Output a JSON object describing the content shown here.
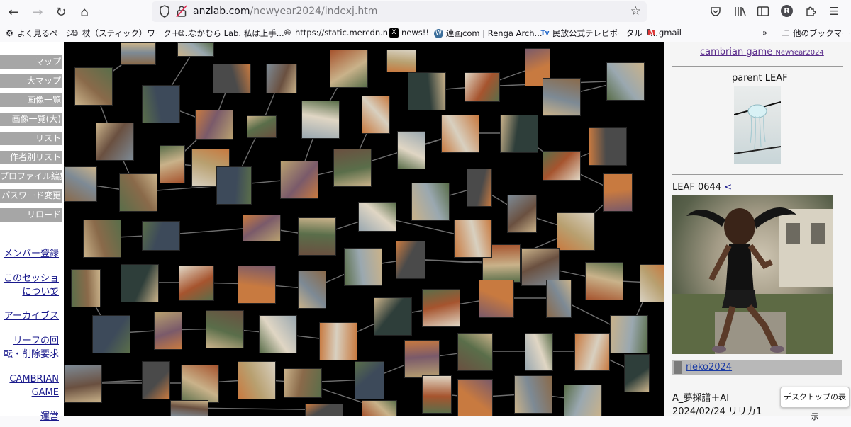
{
  "browser": {
    "url_domain": "anzlab.com",
    "url_path": "/newyear2024/indexj.htm",
    "profile_initial": "R"
  },
  "bookmarks": [
    {
      "label": "よく見るページ",
      "icon": "gear-icon"
    },
    {
      "label": "杖（スティック）ワーク＋ ...",
      "icon": "globe-icon"
    },
    {
      "label": "なかむら Lab. 私は上手...",
      "icon": "globe-icon"
    },
    {
      "label": "https://static.mercdn.n...",
      "icon": "globe-icon"
    },
    {
      "label": "news!!",
      "icon": "x-icon"
    },
    {
      "label": "連画com | Renga Arch...",
      "icon": "wordpress-icon"
    },
    {
      "label": "民放公式テレビポータル「...",
      "icon": "tver-icon"
    },
    {
      "label": "gmail",
      "icon": "gmail-icon"
    }
  ],
  "other_bookmarks": "他のブックマーク",
  "left_nav": {
    "buttons": [
      "マップ",
      "大マップ",
      "画像一覧",
      "画像一覧(大)",
      "リスト",
      "作者別リスト",
      "プロファイル編集",
      "パスワード変更",
      "リロード"
    ],
    "links": [
      "メンバー登録",
      "このセッション",
      "について",
      "アーカイブス",
      "リーフの回",
      "転・削除要求",
      "CAMBRIAN",
      "GAME",
      "運営"
    ]
  },
  "right_panel": {
    "title": "cambrian game",
    "title_sub": "NewYear2024",
    "parent_label": "parent LEAF",
    "leaf_label": "LEAF 0644",
    "leaf_link": "<",
    "author": "rieko2024",
    "desc_line1": "A_夢採譜＋AI",
    "desc_line2": "2024/02/24 リリカ1"
  },
  "tooltip": "デスクトップの表示"
}
